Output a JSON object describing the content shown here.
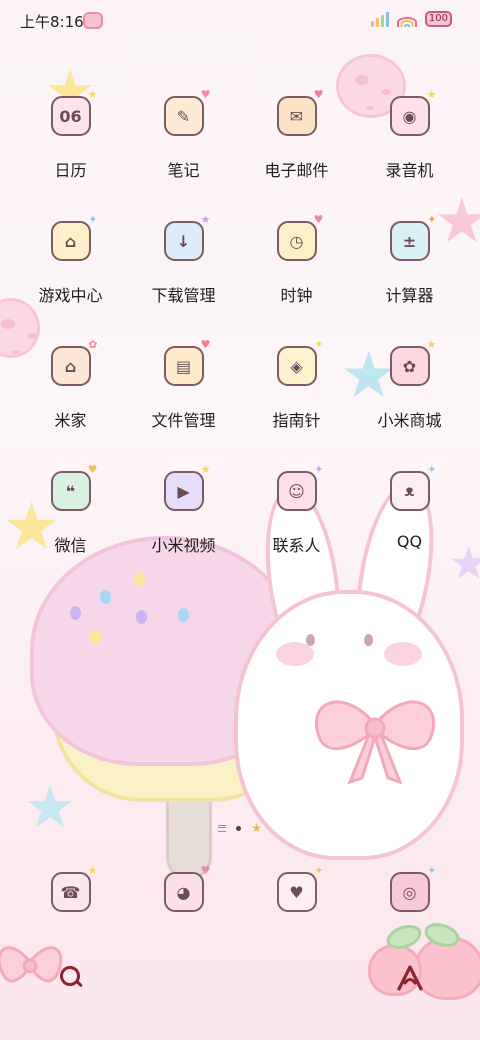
{
  "status_bar": {
    "time": "上午8:16",
    "battery": "100",
    "colors": {
      "signal": [
        "#f4a3bc",
        "#f4c05c",
        "#9ed39c",
        "#89b9ea"
      ],
      "wifi": [
        "#ea6f8f",
        "#f4c05c",
        "#7dc4e8"
      ]
    }
  },
  "apps": [
    {
      "label": "日历",
      "icon": "calendar-icon",
      "glyph": "06",
      "bg": "#fde4ec",
      "sticker": "★",
      "sticker_color": "#f9d64a"
    },
    {
      "label": "笔记",
      "icon": "notes-icon",
      "glyph": "✎",
      "bg": "#fdebd6",
      "sticker": "♥",
      "sticker_color": "#f08aa8"
    },
    {
      "label": "电子邮件",
      "icon": "email-icon",
      "glyph": "✉",
      "bg": "#fbe3c5",
      "sticker": "♥",
      "sticker_color": "#ee7d9a"
    },
    {
      "label": "录音机",
      "icon": "recorder-icon",
      "glyph": "◉",
      "bg": "#fde0ea",
      "sticker": "★",
      "sticker_color": "#f9d64a"
    },
    {
      "label": "游戏中心",
      "icon": "game-center-icon",
      "glyph": "⌂",
      "bg": "#fdf0c8",
      "sticker": "✦",
      "sticker_color": "#8fc7ea"
    },
    {
      "label": "下载管理",
      "icon": "download-manager-icon",
      "glyph": "↓",
      "bg": "#dcecfb",
      "sticker": "★",
      "sticker_color": "#c7a6ef"
    },
    {
      "label": "时钟",
      "icon": "clock-icon",
      "glyph": "◷",
      "bg": "#fdf0c8",
      "sticker": "♥",
      "sticker_color": "#f08aa8"
    },
    {
      "label": "计算器",
      "icon": "calculator-icon",
      "glyph": "±",
      "bg": "#d9f0f4",
      "sticker": "✦",
      "sticker_color": "#f4a04c"
    },
    {
      "label": "米家",
      "icon": "mijia-home-icon",
      "glyph": "⌂",
      "bg": "#fde6d4",
      "sticker": "✿",
      "sticker_color": "#f08aa8"
    },
    {
      "label": "文件管理",
      "icon": "file-manager-icon",
      "glyph": "▤",
      "bg": "#fdeacb",
      "sticker": "♥",
      "sticker_color": "#ee7d9a"
    },
    {
      "label": "指南针",
      "icon": "compass-icon",
      "glyph": "◈",
      "bg": "#fdf3cf",
      "sticker": "✦",
      "sticker_color": "#f9d64a"
    },
    {
      "label": "小米商城",
      "icon": "mi-store-icon",
      "glyph": "✿",
      "bg": "#fdd7df",
      "sticker": "★",
      "sticker_color": "#f9d64a"
    },
    {
      "label": "微信",
      "icon": "wechat-icon",
      "glyph": "❝",
      "bg": "#d8f1e0",
      "sticker": "♥",
      "sticker_color": "#f4c05c"
    },
    {
      "label": "小米视频",
      "icon": "mi-video-icon",
      "glyph": "▶",
      "bg": "#e6dcfb",
      "sticker": "★",
      "sticker_color": "#f9d64a"
    },
    {
      "label": "联系人",
      "icon": "contacts-icon",
      "glyph": "☺",
      "bg": "#fde0ea",
      "sticker": "✦",
      "sticker_color": "#c7a6ef"
    },
    {
      "label": "QQ",
      "icon": "qq-icon",
      "glyph": "ᴥ",
      "bg": "#fdeef2",
      "sticker": "✦",
      "sticker_color": "#8fc7ea"
    }
  ],
  "dock": [
    {
      "icon": "phone-icon",
      "glyph": "☎",
      "bg": "#fde7ee",
      "sticker": "★",
      "sticker_color": "#f9d64a"
    },
    {
      "icon": "messages-icon",
      "glyph": "◕",
      "bg": "#fbe0ea",
      "sticker": "♥",
      "sticker_color": "#f08aa8"
    },
    {
      "icon": "browser-icon",
      "glyph": "♥",
      "bg": "#fdeef2",
      "sticker": "✦",
      "sticker_color": "#f4c05c"
    },
    {
      "icon": "camera-icon",
      "glyph": "◎",
      "bg": "#f8c9d8",
      "sticker": "✦",
      "sticker_color": "#8fc7ea"
    }
  ],
  "bottom_bar": {
    "search_icon": "search-icon",
    "assistant_icon": "assistant-icon",
    "accent": "#8a2530"
  }
}
